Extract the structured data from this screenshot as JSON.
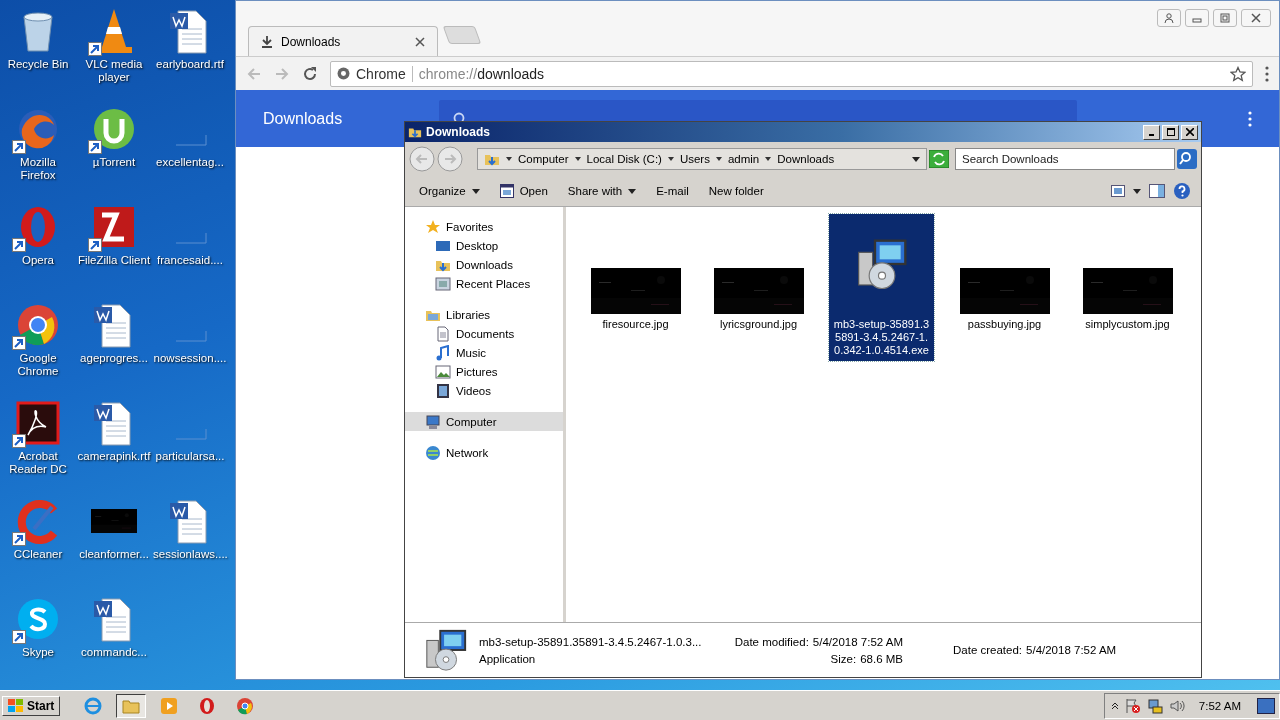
{
  "desktop": {
    "icons": [
      {
        "label": "Recycle Bin",
        "kind": "recycle",
        "shortcut": false
      },
      {
        "label": "Mozilla Firefox",
        "kind": "firefox",
        "shortcut": true
      },
      {
        "label": "Opera",
        "kind": "opera",
        "shortcut": true
      },
      {
        "label": "Google Chrome",
        "kind": "chrome",
        "shortcut": true
      },
      {
        "label": "Acrobat Reader DC",
        "kind": "acrobat",
        "shortcut": true
      },
      {
        "label": "CCleaner",
        "kind": "ccleaner",
        "shortcut": true
      },
      {
        "label": "Skype",
        "kind": "skype",
        "shortcut": true
      },
      {
        "label": "VLC media player",
        "kind": "vlc",
        "shortcut": true
      },
      {
        "label": "µTorrent",
        "kind": "utorrent",
        "shortcut": true
      },
      {
        "label": "FileZilla Client",
        "kind": "filezilla",
        "shortcut": true
      },
      {
        "label": "ageprogres...",
        "kind": "word",
        "shortcut": false
      },
      {
        "label": "camerapink.rtf",
        "kind": "word",
        "shortcut": false
      },
      {
        "label": "cleanformer...",
        "kind": "picture",
        "shortcut": false
      },
      {
        "label": "commandc...",
        "kind": "word",
        "shortcut": false
      },
      {
        "label": "earlyboard.rtf",
        "kind": "word",
        "shortcut": false
      },
      {
        "label": "excellentag...",
        "kind": "blank",
        "shortcut": false
      },
      {
        "label": "francesaid....",
        "kind": "blank",
        "shortcut": false
      },
      {
        "label": "nowsession....",
        "kind": "blank",
        "shortcut": false
      },
      {
        "label": "particularsa...",
        "kind": "blank",
        "shortcut": false
      },
      {
        "label": "sessionlaws....",
        "kind": "word",
        "shortcut": false
      }
    ]
  },
  "browser": {
    "tab": {
      "title": "Downloads"
    },
    "omnibox": {
      "chip": "Chrome",
      "scheme": "chrome://",
      "path": "downloads"
    },
    "header": {
      "title": "Downloads"
    }
  },
  "explorer": {
    "title": "Downloads",
    "breadcrumb": [
      "Computer",
      "Local Disk (C:)",
      "Users",
      "admin",
      "Downloads"
    ],
    "search_placeholder": "Search Downloads",
    "toolbar": [
      {
        "label": "Organize",
        "icon": false,
        "dropdown": true
      },
      {
        "label": "Open",
        "icon": true,
        "dropdown": false
      },
      {
        "label": "Share with",
        "icon": false,
        "dropdown": true
      },
      {
        "label": "E-mail",
        "icon": false,
        "dropdown": false
      },
      {
        "label": "New folder",
        "icon": false,
        "dropdown": false
      }
    ],
    "sidebar": [
      {
        "label": "Favorites",
        "kind": "star",
        "selected": false,
        "children": [
          {
            "label": "Desktop",
            "kind": "desktop",
            "selected": false
          },
          {
            "label": "Downloads",
            "kind": "folder",
            "selected": false
          },
          {
            "label": "Recent Places",
            "kind": "recent",
            "selected": false
          }
        ]
      },
      {
        "label": "Libraries",
        "kind": "library",
        "selected": false,
        "children": [
          {
            "label": "Documents",
            "kind": "document",
            "selected": false
          },
          {
            "label": "Music",
            "kind": "music",
            "selected": false
          },
          {
            "label": "Pictures",
            "kind": "pictures",
            "selected": false
          },
          {
            "label": "Videos",
            "kind": "videos",
            "selected": false
          }
        ]
      },
      {
        "label": "Computer",
        "kind": "computer",
        "selected": true
      },
      {
        "label": "Network",
        "kind": "network",
        "selected": false
      }
    ],
    "files": [
      {
        "name": "firesource.jpg",
        "selected": false
      },
      {
        "name": "lyricsground.jpg",
        "selected": false
      },
      {
        "name": "mb3-setup-35891.35891-3.4.5.2467-1.0.342-1.0.4514.exe",
        "kind": "installer",
        "selected": true
      },
      {
        "name": "passbuying.jpg",
        "selected": false
      },
      {
        "name": "simplycustom.jpg",
        "selected": false
      }
    ],
    "details": {
      "name": "mb3-setup-35891.35891-3.4.5.2467-1.0.3...",
      "type": "Application",
      "modified_label": "Date modified:",
      "modified": "5/4/2018 7:52 AM",
      "size_label": "Size:",
      "size": "68.6 MB",
      "created_label": "Date created:",
      "created": "5/4/2018 7:52 AM"
    }
  },
  "taskbar": {
    "start": "Start",
    "apps": [
      {
        "kind": "ie",
        "selected": false
      },
      {
        "kind": "explorer",
        "selected": true
      },
      {
        "kind": "media",
        "selected": false
      },
      {
        "kind": "opera",
        "selected": false
      },
      {
        "kind": "chrome",
        "selected": false
      }
    ],
    "time": "7:52 AM"
  }
}
